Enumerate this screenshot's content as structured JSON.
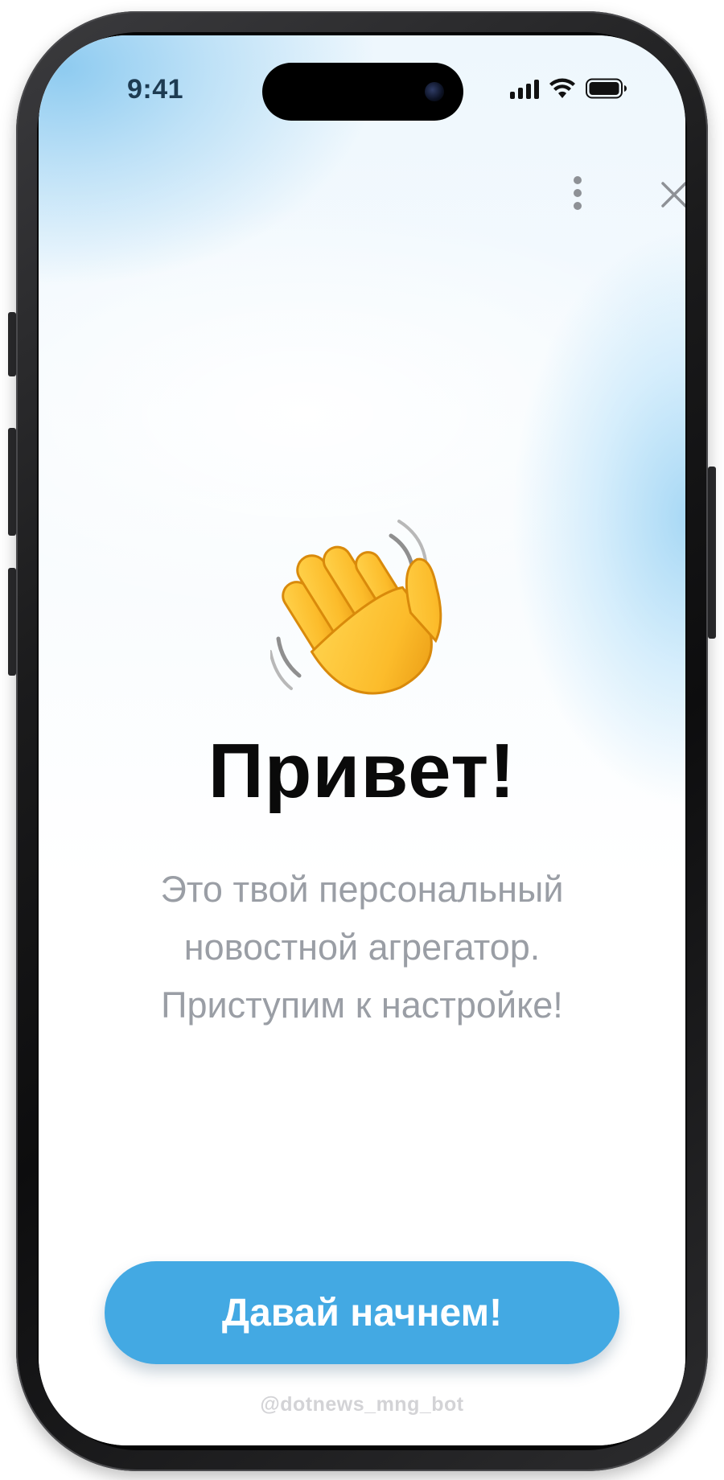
{
  "status_bar": {
    "time": "9:41",
    "icons": [
      "signal-icon",
      "wifi-icon",
      "battery-icon"
    ]
  },
  "top_actions": {
    "icons": [
      "more-vertical-icon",
      "close-icon"
    ]
  },
  "hero": {
    "emoji": "waving-hand-icon",
    "title": "Привет!",
    "subtitle_lines": [
      "Это твой персональный",
      "новостной агрегатор.",
      "Приступим к настройке!"
    ]
  },
  "cta": {
    "label": "Давай начнем!"
  },
  "footer": {
    "bot_handle": "@dotnews_mng_bot"
  },
  "colors": {
    "accent": "#43a9e3",
    "title": "#0a0a0a",
    "subtitle": "#9a9ea5",
    "handle": "#d3d3d6",
    "background_tint": "#8ecbf0"
  }
}
